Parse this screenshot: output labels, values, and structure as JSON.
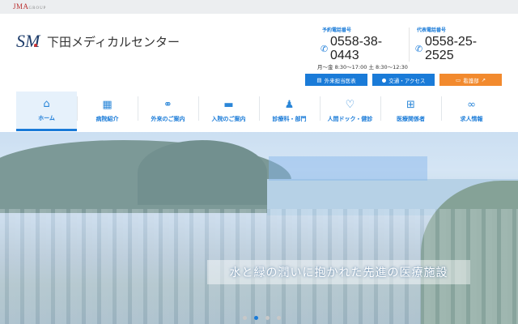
{
  "topbar": {
    "group_main": "JMA",
    "group_sub": "GROUP"
  },
  "logo": {
    "mark": "SM",
    "name": "下田メディカルセンター"
  },
  "contact": {
    "reservation": {
      "label": "予約電話番号",
      "number": "0558-38-0443"
    },
    "main": {
      "label": "代表電話番号",
      "number": "0558-25-2525"
    },
    "hours": "月〜金 8:30〜17:00 土 8:30〜12:30"
  },
  "buttons": [
    {
      "label": "外来担当医表",
      "color": "#1a7bd8",
      "icon": "clipboard-icon"
    },
    {
      "label": "交通・アクセス",
      "color": "#1a7bd8",
      "icon": "map-pin-icon"
    },
    {
      "label": "看護部",
      "color": "#f28a2e",
      "icon": "external-link-icon"
    }
  ],
  "nav": [
    {
      "label": "ホーム",
      "icon": "home-icon",
      "active": true
    },
    {
      "label": "病院紹介",
      "icon": "hospital-icon"
    },
    {
      "label": "外来のご案内",
      "icon": "stethoscope-icon"
    },
    {
      "label": "入院のご案内",
      "icon": "bed-icon"
    },
    {
      "label": "診療科・部門",
      "icon": "doctor-icon"
    },
    {
      "label": "人間ドック・健診",
      "icon": "heart-icon"
    },
    {
      "label": "医療関係者",
      "icon": "medical-kit-icon"
    },
    {
      "label": "求人情報",
      "icon": "people-icon"
    }
  ],
  "hero": {
    "caption": "水と緑の潤いに抱かれた先進の医療施設",
    "slides": 4,
    "active_slide": 2
  },
  "colors": {
    "accent": "#1a7bd8",
    "orange": "#f28a2e"
  }
}
